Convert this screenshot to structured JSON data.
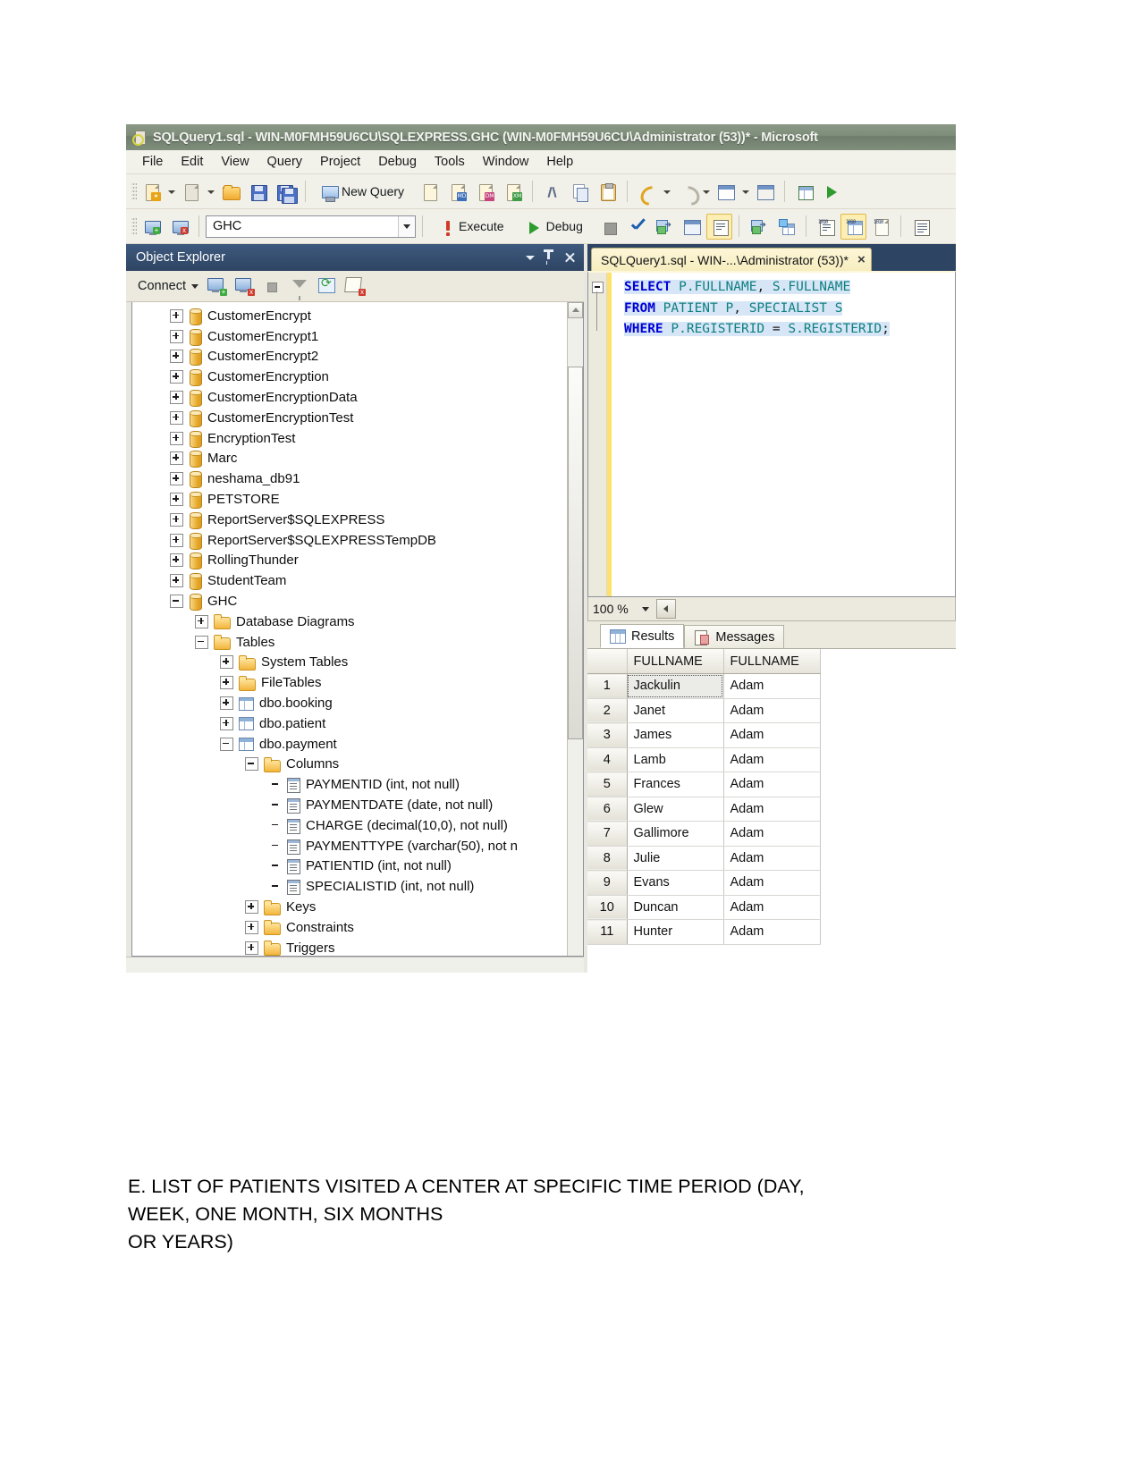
{
  "window": {
    "title": "SQLQuery1.sql - WIN-M0FMH59U6CU\\SQLEXPRESS.GHC (WIN-M0FMH59U6CU\\Administrator (53))* - Microsoft",
    "app_icon": "sql-query-icon"
  },
  "menubar": {
    "items": [
      "File",
      "Edit",
      "View",
      "Query",
      "Project",
      "Debug",
      "Tools",
      "Window",
      "Help"
    ]
  },
  "toolbar1": {
    "new_query_label": "New Query",
    "icons": [
      "new-item-icon",
      "add-new-item-icon",
      "open-file-icon",
      "save-icon",
      "save-all-icon",
      "new-query-icon",
      "new-db-query-icon",
      "new-mdx-query-icon",
      "new-dmx-query-icon",
      "new-xmla-query-icon",
      "cut-icon",
      "copy-icon",
      "paste-icon",
      "undo-icon",
      "redo-icon",
      "navigate-icon",
      "window-icon",
      "designer-icon",
      "run-icon"
    ]
  },
  "toolbar2": {
    "database_value": "GHC",
    "execute_label": "Execute",
    "debug_label": "Debug",
    "icons": [
      "connect-icon",
      "disconnect-icon",
      "execute-icon",
      "debug-icon",
      "stop-icon",
      "parse-icon",
      "display-estimated-plan-icon",
      "query-options-icon",
      "include-actual-plan-icon",
      "include-client-statistics-icon",
      "results-to-text-icon",
      "results-to-grid-icon",
      "results-to-file-icon",
      "comment-icon"
    ]
  },
  "object_explorer": {
    "title": "Object Explorer",
    "connect_label": "Connect",
    "toolbar_icons": [
      "connect-server-icon",
      "disconnect-server-icon",
      "stop-icon",
      "filter-icon",
      "refresh-icon",
      "script-icon"
    ],
    "header_icons": [
      "chevron-down-icon",
      "pin-icon",
      "close-icon"
    ],
    "tree": [
      {
        "label": "CustomerEncrypt",
        "icon": "database-icon",
        "indent": 1,
        "state": "collapsed"
      },
      {
        "label": "CustomerEncrypt1",
        "icon": "database-icon",
        "indent": 1,
        "state": "collapsed"
      },
      {
        "label": "CustomerEncrypt2",
        "icon": "database-icon",
        "indent": 1,
        "state": "collapsed"
      },
      {
        "label": "CustomerEncryption",
        "icon": "database-icon",
        "indent": 1,
        "state": "collapsed"
      },
      {
        "label": "CustomerEncryptionData",
        "icon": "database-icon",
        "indent": 1,
        "state": "collapsed"
      },
      {
        "label": "CustomerEncryptionTest",
        "icon": "database-icon",
        "indent": 1,
        "state": "collapsed"
      },
      {
        "label": "EncryptionTest",
        "icon": "database-icon",
        "indent": 1,
        "state": "collapsed"
      },
      {
        "label": "Marc",
        "icon": "database-icon",
        "indent": 1,
        "state": "collapsed"
      },
      {
        "label": "neshama_db91",
        "icon": "database-icon",
        "indent": 1,
        "state": "collapsed"
      },
      {
        "label": "PETSTORE",
        "icon": "database-icon",
        "indent": 1,
        "state": "collapsed"
      },
      {
        "label": "ReportServer$SQLEXPRESS",
        "icon": "database-icon",
        "indent": 1,
        "state": "collapsed"
      },
      {
        "label": "ReportServer$SQLEXPRESSTempDB",
        "icon": "database-icon",
        "indent": 1,
        "state": "collapsed"
      },
      {
        "label": "RollingThunder",
        "icon": "database-icon",
        "indent": 1,
        "state": "collapsed"
      },
      {
        "label": "StudentTeam",
        "icon": "database-icon",
        "indent": 1,
        "state": "collapsed"
      },
      {
        "label": "GHC",
        "icon": "database-icon",
        "indent": 1,
        "state": "expanded"
      },
      {
        "label": "Database Diagrams",
        "icon": "folder-icon",
        "indent": 2,
        "state": "collapsed"
      },
      {
        "label": "Tables",
        "icon": "folder-icon",
        "indent": 2,
        "state": "expanded"
      },
      {
        "label": "System Tables",
        "icon": "folder-icon",
        "indent": 3,
        "state": "collapsed"
      },
      {
        "label": "FileTables",
        "icon": "folder-icon",
        "indent": 3,
        "state": "collapsed"
      },
      {
        "label": "dbo.booking",
        "icon": "table-icon",
        "indent": 3,
        "state": "collapsed"
      },
      {
        "label": "dbo.patient",
        "icon": "table-icon",
        "indent": 3,
        "state": "collapsed"
      },
      {
        "label": "dbo.payment",
        "icon": "table-icon",
        "indent": 3,
        "state": "expanded"
      },
      {
        "label": "Columns",
        "icon": "folder-icon",
        "indent": 4,
        "state": "expanded"
      },
      {
        "label": "PAYMENTID (int, not null)",
        "icon": "column-icon",
        "indent": 5,
        "state": "leaf"
      },
      {
        "label": "PAYMENTDATE (date, not null)",
        "icon": "column-icon",
        "indent": 5,
        "state": "leaf"
      },
      {
        "label": "CHARGE (decimal(10,0), not null)",
        "icon": "column-icon",
        "indent": 5,
        "state": "leaf"
      },
      {
        "label": "PAYMENTTYPE (varchar(50), not n",
        "icon": "column-icon",
        "indent": 5,
        "state": "leaf"
      },
      {
        "label": "PATIENTID (int, not null)",
        "icon": "column-icon",
        "indent": 5,
        "state": "leaf"
      },
      {
        "label": "SPECIALISTID (int, not null)",
        "icon": "column-icon",
        "indent": 5,
        "state": "leaf"
      },
      {
        "label": "Keys",
        "icon": "folder-icon",
        "indent": 4,
        "state": "collapsed"
      },
      {
        "label": "Constraints",
        "icon": "folder-icon",
        "indent": 4,
        "state": "collapsed"
      },
      {
        "label": "Triggers",
        "icon": "folder-icon",
        "indent": 4,
        "state": "collapsed"
      }
    ]
  },
  "editor": {
    "tab_label": "SQLQuery1.sql - WIN-...\\Administrator (53))*",
    "tab_close": "×",
    "zoom_value": "100 %",
    "code_lines": [
      [
        {
          "t": "SELECT",
          "c": "kw"
        },
        {
          "t": " ",
          "c": "pl"
        },
        {
          "t": "P.FULLNAME",
          "c": "id"
        },
        {
          "t": ", ",
          "c": "pl"
        },
        {
          "t": "S.FULLNAME",
          "c": "id"
        }
      ],
      [
        {
          "t": "FROM",
          "c": "kw"
        },
        {
          "t": " ",
          "c": "pl"
        },
        {
          "t": "PATIENT P",
          "c": "id"
        },
        {
          "t": ", ",
          "c": "pl"
        },
        {
          "t": "SPECIALIST S",
          "c": "id"
        }
      ],
      [
        {
          "t": "WHERE",
          "c": "kw"
        },
        {
          "t": " ",
          "c": "pl"
        },
        {
          "t": "P.REGISTERID",
          "c": "id"
        },
        {
          "t": " = ",
          "c": "pl"
        },
        {
          "t": "S.REGISTERID",
          "c": "id"
        },
        {
          "t": ";",
          "c": "pl"
        }
      ]
    ]
  },
  "results": {
    "tabs": [
      {
        "label": "Results",
        "icon": "results-grid-icon",
        "active": true
      },
      {
        "label": "Messages",
        "icon": "messages-icon",
        "active": false
      }
    ],
    "columns": [
      "",
      "FULLNAME",
      "FULLNAME"
    ],
    "rows": [
      {
        "n": "1",
        "c1": "Jackulin",
        "c2": "Adam",
        "selected": true
      },
      {
        "n": "2",
        "c1": "Janet",
        "c2": "Adam",
        "selected": false
      },
      {
        "n": "3",
        "c1": "James",
        "c2": "Adam",
        "selected": false
      },
      {
        "n": "4",
        "c1": "Lamb",
        "c2": "Adam",
        "selected": false
      },
      {
        "n": "5",
        "c1": "Frances",
        "c2": "Adam",
        "selected": false
      },
      {
        "n": "6",
        "c1": "Glew",
        "c2": "Adam",
        "selected": false
      },
      {
        "n": "7",
        "c1": "Gallimore",
        "c2": "Adam",
        "selected": false
      },
      {
        "n": "8",
        "c1": "Julie",
        "c2": "Adam",
        "selected": false
      },
      {
        "n": "9",
        "c1": "Evans",
        "c2": "Adam",
        "selected": false
      },
      {
        "n": "10",
        "c1": "Duncan",
        "c2": "Adam",
        "selected": false
      },
      {
        "n": "11",
        "c1": "Hunter",
        "c2": "Adam",
        "selected": false
      }
    ]
  },
  "document": {
    "caption_line1": "E. LIST OF PATIENTS VISITED A CENTER AT SPECIFIC TIME PERIOD (DAY,",
    "caption_line2": "WEEK, ONE MONTH, SIX MONTHS",
    "caption_line3": "OR YEARS)"
  },
  "colors": {
    "title_bar": "#7d8c79",
    "panel_header": "#2e4463",
    "keyword": "#0000d4",
    "identifier": "#0e7f7f",
    "tab_active": "#fdf6d8"
  }
}
